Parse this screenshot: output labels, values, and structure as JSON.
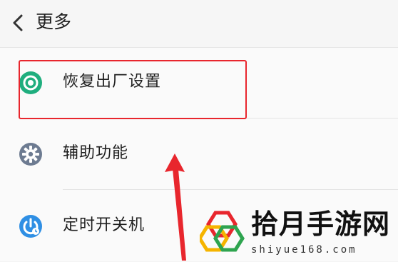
{
  "header": {
    "back_icon": "chevron-left-icon",
    "title": "更多"
  },
  "items": [
    {
      "label": "恢复出厂设置",
      "icon": "restore-icon",
      "icon_color": "#1fae7e"
    },
    {
      "label": "辅助功能",
      "icon": "accessibility-gear-icon",
      "icon_color": "#6d7b91"
    },
    {
      "label": "定时开关机",
      "icon": "timer-power-icon",
      "icon_color": "#2f8fe4"
    }
  ],
  "annotations": {
    "highlight_color": "#e8262d",
    "arrow_color": "#e8262d"
  },
  "watermark": {
    "text": "拾月手游网",
    "url": "shiyue168.com"
  }
}
